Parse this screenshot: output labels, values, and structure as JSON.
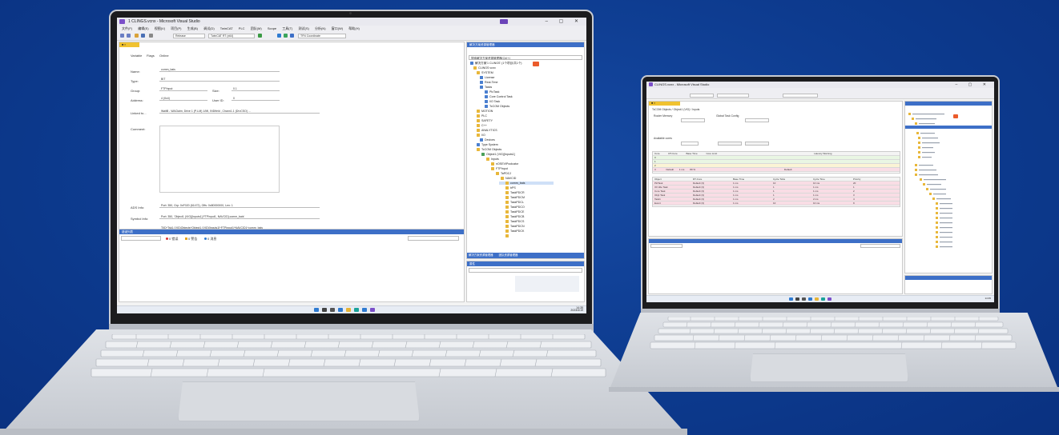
{
  "large_laptop": {
    "window_title": "1 CLINGS.vcnx - Microsoft Visual Studio",
    "menu": [
      "文件(F)",
      "编辑(E)",
      "视图(V)",
      "项目(P)",
      "生成(B)",
      "调试(D)",
      "TwinCAT",
      "PLC",
      "团队(M)",
      "Scope",
      "工具(T)",
      "测试(S)",
      "分析(N)",
      "窗口(W)",
      "帮助(H)"
    ],
    "toolbar_combos": [
      "Release",
      "TwinCAT RT (x64)",
      "TFN Coordinate"
    ],
    "editor_tabs": [
      "Variable",
      "Flags",
      "Online"
    ],
    "form": {
      "name_label": "Name:",
      "name_value": "comm_bais",
      "type_label": "Type:",
      "type_value": "BIT",
      "group_label": "Group:",
      "group_value": "FTPInput",
      "size_label": "Size:",
      "size_value": "0.1",
      "address_label": "Address:",
      "address_value": "4 (0x4)",
      "user_id_label": "User ID:",
      "user_id_value": "0",
      "linked_label": "Linked to...",
      "linked_value": "WaitB - WAClaim, Drive 1 (P-LM) 1/MI, INDfield , Chann1.1 (DrvCSO) ...",
      "comment_label": "Comment:",
      "ads_label": "ADS Info:",
      "ads_value": "Port: 350, Grp: 0xF020 (61472), Offs: 0x80000000, Len: 1",
      "symbol_label": "Symbol Info:",
      "symbol_value": "Port: 350, 'Object1 (VIG)[Inputs1].FTPinput1, NAVCID].comm_bais'",
      "full_label": "Full Name:",
      "full_value": "TIID^Tsk1 (VIG)Objects^Object1 (VIG)[Inputs1]^FTPinput1^NAVCID1^comm_bais"
    },
    "output_title": "错误列表",
    "output_filter": [
      "0 错误",
      "0 警告",
      "0 消息"
    ],
    "solution_title": "解决方案资源管理器",
    "solution_search": "搜索解决方案资源管理器(Ctrl+;)",
    "tree": [
      "解决方案'1 CLINGS' (1个项目/共1个)",
      "CLINGS vcnx",
      "SYSTEM",
      "License",
      "Real-Time",
      "Tasks",
      "PlcTask",
      "Core Control Task",
      "I/O Task",
      "TcCOM Objects",
      "MOTION",
      "PLC",
      "SAFETY",
      "C++",
      "ANALYTICS",
      "I/O",
      "Devices",
      "Type System",
      "TcCOM Objects",
      "Object1 (VIG)[Inputs1]",
      "Inputs",
      "nOSEVIPoolcator",
      "FTPInput",
      "TaPDCJ",
      "NAVCID",
      "comm_bais",
      "bPS",
      "TaskPDCR",
      "TaskPDCM",
      "TaskPDCL",
      "TaskPDCO",
      "TaskPDCE",
      "TaskPDCB",
      "TaskPDCS",
      "TaskPDCN",
      "TaskPDCK"
    ],
    "solution_tabs": [
      "解决方案资源管理器",
      "团队资源管理器"
    ],
    "props_title": "属性",
    "taskbar_time": "14:35",
    "taskbar_date": "2023/4/19"
  },
  "small_laptop": {
    "window_title": "CLINGS.vcnx - Microsoft Visual Studio",
    "editor_header": "TcCOM Objects / Object1 (VIG) / Inputs",
    "section_left": "Router Memory",
    "section_right": "Global Task Config",
    "avail_label": "Available cores",
    "grid_headers": [
      "Core",
      "RT-Core",
      "Base Time",
      "Core Limit",
      "Latency Warning"
    ],
    "grid_rows": [
      [
        "0",
        "",
        "",
        "",
        ""
      ],
      [
        "1",
        "",
        "",
        "",
        ""
      ],
      [
        "2",
        "",
        "",
        "",
        ""
      ],
      [
        "3",
        "Default",
        "1 ms",
        "80 %",
        "Default"
      ]
    ],
    "task_headers": [
      "Object",
      "RT-Core",
      "Base Time",
      "Cycle Ticks",
      "Cycle Time",
      "Priority"
    ],
    "task_rows": [
      [
        "PlcTask",
        "Default (3)",
        "1 ms",
        "10",
        "10 ms",
        "20"
      ],
      [
        "I/O Idle Task",
        "Default (3)",
        "1 ms",
        "1",
        "1 ms",
        "1"
      ],
      [
        "Core Task",
        "Default (3)",
        "1 ms",
        "1",
        "1 ms",
        "2"
      ],
      [
        "Obj1 Task",
        "Default (3)",
        "1 ms",
        "1",
        "1 ms",
        "3"
      ],
      [
        "Task1",
        "Default (3)",
        "1 ms",
        "2",
        "2 ms",
        "4"
      ],
      [
        "Event",
        "Default (3)",
        "1 ms",
        "10",
        "10 ms",
        "9"
      ]
    ],
    "taskbar_time": "14:35"
  }
}
